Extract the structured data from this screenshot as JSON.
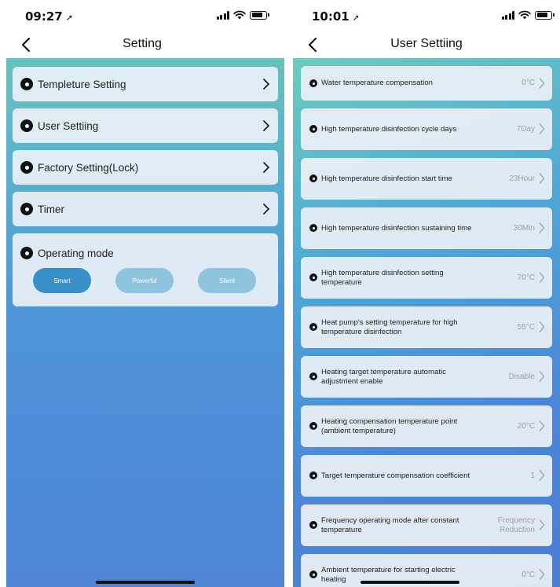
{
  "screen1": {
    "status": {
      "time": "09:27"
    },
    "title": "Setting",
    "items": [
      {
        "label": "Templeture Setting"
      },
      {
        "label": "User Settiing"
      },
      {
        "label": "Factory Setting(Lock)"
      },
      {
        "label": "Timer"
      }
    ],
    "operating_mode": {
      "label": "Operating mode",
      "options": [
        "Smart",
        "Powerful",
        "Slient"
      ],
      "selected": "Smart"
    }
  },
  "screen2": {
    "status": {
      "time": "10:01"
    },
    "title": "User Settiing",
    "items": [
      {
        "label": "Water temperature compensation",
        "value": "0°C"
      },
      {
        "label": "High temperature disinfection cycle days",
        "value": "7Day"
      },
      {
        "label": "High temperature disinfection start time",
        "value": "23Hour"
      },
      {
        "label": "High temperature disinfection sustaining time",
        "value": "30Min"
      },
      {
        "label": "High temperature disinfection setting temperature",
        "value": "70°C"
      },
      {
        "label": "Heat pump's setting temperature for high temperature disinfection",
        "value": "55°C"
      },
      {
        "label": "Heating target temperature automatic adjustment enable",
        "value": "Disable"
      },
      {
        "label": "Heating compensation temperature point (ambient temperature)",
        "value": "20°C"
      },
      {
        "label": "Target temperature compensation coefficient",
        "value": "1"
      },
      {
        "label": "Frequency operating mode after constant temperature",
        "value": "Frequency Reduction"
      },
      {
        "label": "Ambient temperature for starting electric heating",
        "value": "0°C"
      }
    ]
  },
  "colors": {
    "mode_selected": "#3a8fc6",
    "mode_unselected": "#8ec4dd",
    "accent": "#4e8fd6"
  }
}
